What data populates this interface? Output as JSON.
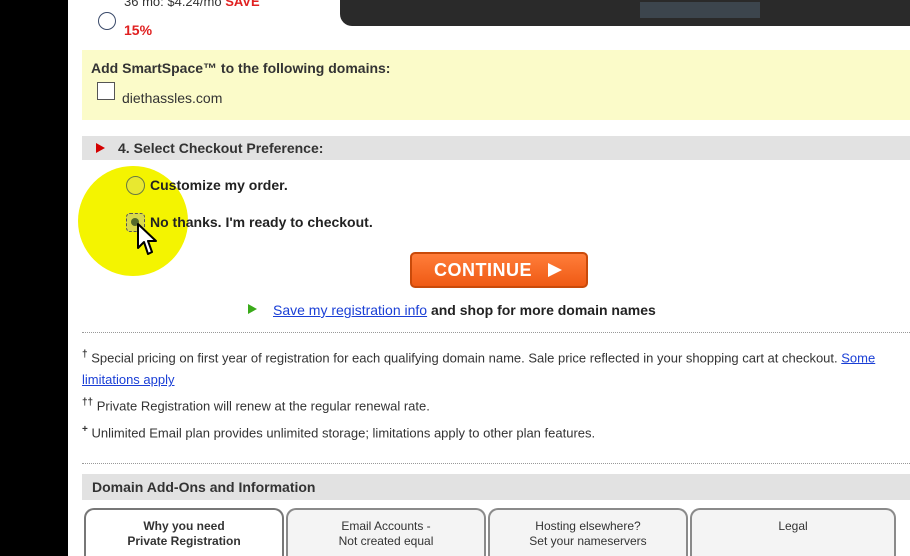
{
  "plan": {
    "price_text": "36 mo: $4.24/mo",
    "save_text": "SAVE",
    "save_pct": "15%"
  },
  "smartspace": {
    "title": "Add SmartSpace™ to the following domains:",
    "domain": "diethassles.com"
  },
  "checkout": {
    "section_title": "4. Select Checkout Preference:",
    "option_customize": "Customize my order.",
    "option_checkout": "No thanks. I'm ready to checkout.",
    "continue_label": "CONTINUE"
  },
  "save_reg": {
    "link_text": "Save my registration info",
    "rest_text": "and shop for more domain names"
  },
  "notes": {
    "n1_mark": "†",
    "n1_text": "Special pricing on first year of registration for each qualifying domain name. Sale price reflected in your shopping cart at checkout.",
    "n1_link": "Some limitations apply",
    "n2_mark": "††",
    "n2_text": "Private Registration will renew at the regular renewal rate.",
    "n3_mark": "+",
    "n3_text": "Unlimited Email plan provides unlimited storage; limitations apply to other plan features."
  },
  "addons": {
    "title": "Domain Add-Ons and Information",
    "tabs": [
      {
        "line1": "Why you need",
        "line2": "Private Registration"
      },
      {
        "line1": "Email Accounts -",
        "line2": "Not created equal"
      },
      {
        "line1": "Hosting elsewhere?",
        "line2": "Set your nameservers"
      },
      {
        "line1": "Legal",
        "line2": ""
      }
    ]
  },
  "colors": {
    "accent_orange": "#f26522",
    "save_red": "#e02020",
    "highlight_yellow": "#f4f400",
    "link_blue": "#1a3fd6"
  }
}
